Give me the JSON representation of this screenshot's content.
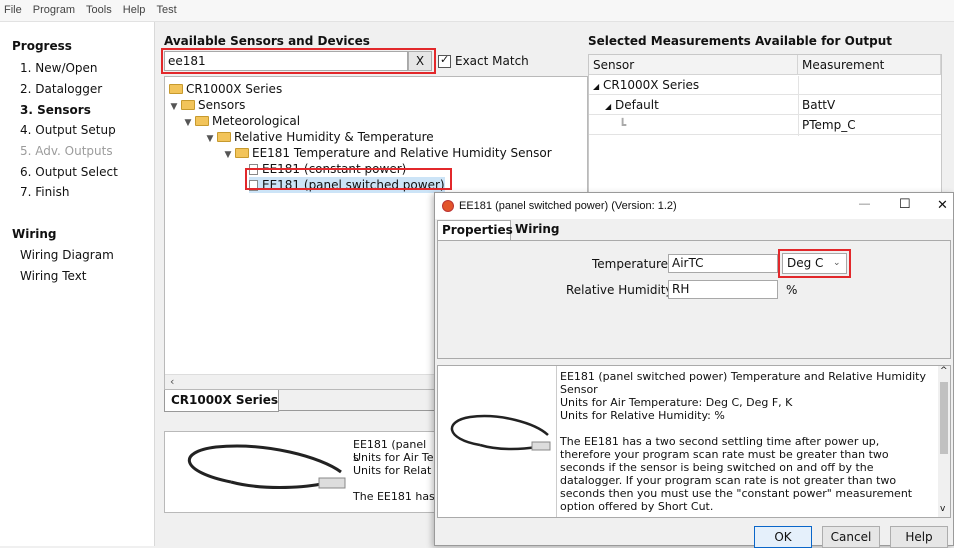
{
  "menu": {
    "file": "File",
    "program": "Program",
    "tools": "Tools",
    "help": "Help",
    "test": "Test"
  },
  "progress": {
    "title": "Progress",
    "steps": [
      "1. New/Open",
      "2. Datalogger",
      "3. Sensors",
      "4. Output Setup",
      "5. Adv. Outputs",
      "6. Output Select",
      "7. Finish"
    ]
  },
  "wiring": {
    "title": "Wiring",
    "items": [
      "Wiring Diagram",
      "Wiring Text"
    ]
  },
  "sensors": {
    "title": "Available Sensors and Devices",
    "search_value": "ee181",
    "clear_label": "X",
    "exact_match_label": "Exact Match",
    "tree": {
      "root": "CR1000X Series",
      "sensors": "Sensors",
      "meteorological": "Meteorological",
      "rh_temp": "Relative Humidity & Temperature",
      "ee181_group": "EE181 Temperature and Relative Humidity Sensor",
      "ee181_constant": "EE181 (constant power)",
      "ee181_switched": "EE181 (panel switched power)"
    },
    "tab_label": "CR1000X Series",
    "preview_lines": [
      "EE181 (panel s",
      "Units for Air Te",
      "Units for Relat",
      "The EE181 has"
    ]
  },
  "selected": {
    "title": "Selected Measurements Available for Output",
    "col_sensor": "Sensor",
    "col_measurement": "Measurement",
    "row_series": "CR1000X Series",
    "row_default": "Default",
    "meas_1": "BattV",
    "meas_2": "PTemp_C"
  },
  "dialog": {
    "title": "EE181 (panel switched power) (Version: 1.2)",
    "minimize": "—",
    "maximize": "☐",
    "close": "✕",
    "tab_properties": "Properties",
    "tab_wiring": "Wiring",
    "temperature_label": "Temperature",
    "temperature_value": "AirTC",
    "temperature_units": "Deg C",
    "rh_label": "Relative Humidity",
    "rh_value": "RH",
    "rh_units": "%",
    "description": [
      "EE181 (panel switched power) Temperature and Relative Humidity",
      "Sensor",
      "Units for Air Temperature: Deg C, Deg F, K",
      "Units for Relative Humidity: %",
      "",
      "The EE181 has a two second settling time after power up,",
      "therefore your program scan rate must be greater than two",
      "seconds if the sensor is being switched on and off by the",
      "datalogger. If your program scan rate is not greater than two",
      "seconds then you must use the \"constant power\" measurement",
      "option offered by Short Cut."
    ],
    "ok": "OK",
    "cancel": "Cancel",
    "help": "Help"
  },
  "colors": {
    "highlight": "#e2282b",
    "background": "#f0f0f0"
  }
}
